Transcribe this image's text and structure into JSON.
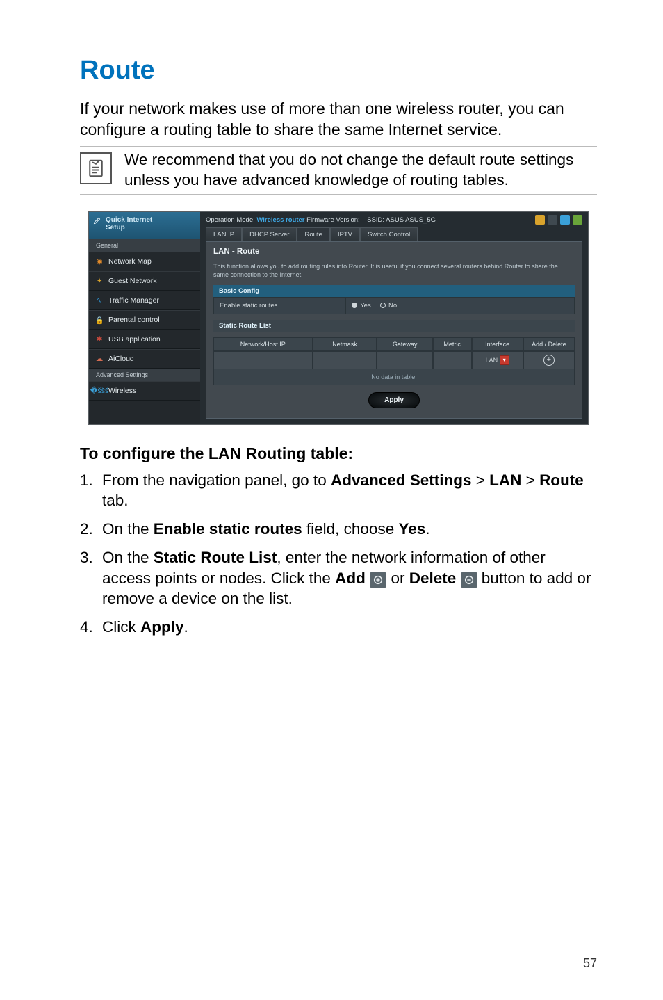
{
  "page": {
    "number": "57",
    "heading": "Route",
    "intro": "If your network makes use of more than one wireless router, you can configure a routing table to share the same Internet service.",
    "note": "We recommend that you do not change the default route settings unless you have advanced knowledge of routing tables.",
    "subhead": "To configure the LAN Routing table:"
  },
  "steps": {
    "s1a": "From the navigation panel, go to ",
    "s1b": "Advanced Settings",
    "s1c": " > ",
    "s1d": "LAN",
    "s1e": " > ",
    "s1f": "Route",
    "s1g": " tab.",
    "s2a": "On the ",
    "s2b": "Enable static routes",
    "s2c": " field, choose ",
    "s2d": "Yes",
    "s2e": ".",
    "s3a": "On the ",
    "s3b": "Static Route List",
    "s3c": ", enter the network information of other access points or nodes. Click the ",
    "s3d": "Add",
    "s3e": "  or ",
    "s3f": "Delete",
    "s3g": " button to add or remove a device on the list.",
    "s4a": "Click ",
    "s4b": "Apply",
    "s4c": "."
  },
  "shot": {
    "quick": "Quick Internet\nSetup",
    "sec1": "General",
    "sec2": "Advanced Settings",
    "nav": {
      "map": "Network Map",
      "guest": "Guest Network",
      "traffic": "Traffic Manager",
      "parental": "Parental control",
      "usb": "USB application",
      "aicloud": "AiCloud",
      "wireless": "Wireless"
    },
    "topbarLeft1": "Operation Mode: ",
    "topbarLeft2": "Wireless router",
    "topbarLeft3": "   Firmware Version: ",
    "topbarSsid": "SSID: ASUS  ASUS_5G",
    "tabs": {
      "lanip": "LAN IP",
      "dhcp": "DHCP Server",
      "route": "Route",
      "iptv": "IPTV",
      "switch": "Switch Control"
    },
    "panelTitle": "LAN - Route",
    "panelDesc": "This function allows you to add routing rules into Router. It is useful if you connect several routers behind Router to share the same connection to the Internet.",
    "basicHead": "Basic Config",
    "enableLabel": "Enable static routes",
    "yes": "Yes",
    "no": "No",
    "listHead": "Static Route List",
    "cols": {
      "c1": "Network/Host IP",
      "c2": "Netmask",
      "c3": "Gateway",
      "c4": "Metric",
      "c5": "Interface",
      "c6": "Add / Delete"
    },
    "iface": "LAN",
    "nodata": "No data in table.",
    "apply": "Apply"
  }
}
